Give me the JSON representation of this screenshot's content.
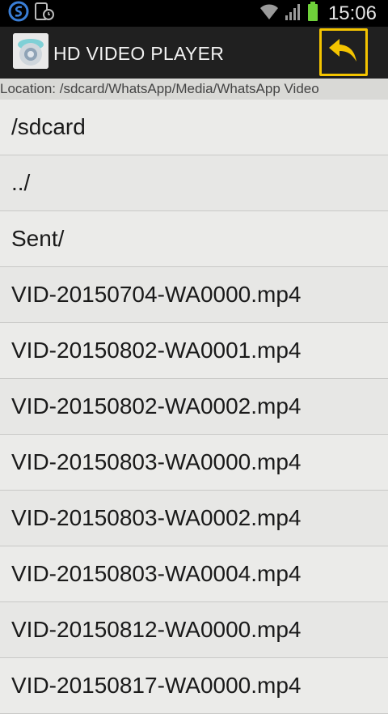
{
  "status_bar": {
    "time": "15:06",
    "icons": [
      "samsung-s-icon",
      "tablet-clock-icon",
      "wifi-icon",
      "signal-icon",
      "battery-icon"
    ]
  },
  "action_bar": {
    "title": "HD VIDEO PLAYER",
    "back_button_icon": "reply-arrow-icon",
    "accent_color": "#f4c400"
  },
  "location": {
    "text": "Location: /sdcard/WhatsApp/Media/WhatsApp Video"
  },
  "files": [
    {
      "name": "/sdcard"
    },
    {
      "name": "../"
    },
    {
      "name": "Sent/"
    },
    {
      "name": "VID-20150704-WA0000.mp4"
    },
    {
      "name": "VID-20150802-WA0001.mp4"
    },
    {
      "name": "VID-20150802-WA0002.mp4"
    },
    {
      "name": "VID-20150803-WA0000.mp4"
    },
    {
      "name": "VID-20150803-WA0002.mp4"
    },
    {
      "name": "VID-20150803-WA0004.mp4"
    },
    {
      "name": "VID-20150812-WA0000.mp4"
    },
    {
      "name": "VID-20150817-WA0000.mp4"
    }
  ]
}
